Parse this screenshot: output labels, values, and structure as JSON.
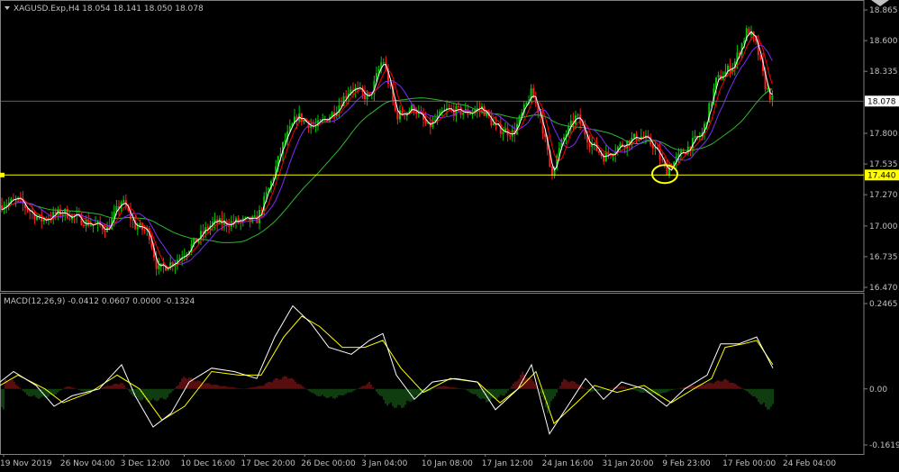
{
  "header": {
    "symbol_line": "XAGUSD.Exp,H4  18.054 18.141 18.050 18.078",
    "indicator_line": "MACD(12,26,9) -0.0412 0.0607 0.0000 -0.1324"
  },
  "colors": {
    "background": "#000000",
    "axis": "#808080",
    "text": "#c0c0c0",
    "bull_bar": "#00c800",
    "bear_bar": "#ff2020",
    "ma_fast": "#ffffff",
    "ma_mid": "#ff0000",
    "ma_slow": "#7a2cff",
    "ma_trend": "#2eb82e",
    "macd_line": "#ffffff",
    "signal_line": "#ffff00",
    "hist_pos": "#b01c1c",
    "hist_neg": "#1f7a1f",
    "level_line": "#ffff00",
    "level_label_bg": "#ffff00",
    "price_label_bg": "#ffffff",
    "marker": "#ffff00"
  },
  "chart_data": [
    {
      "type": "candlestick",
      "title": "XAGUSD.Exp,H4",
      "ohlc_readout": {
        "open": 18.054,
        "high": 18.141,
        "low": 18.05,
        "close": 18.078
      },
      "ylim": [
        16.47,
        18.92
      ],
      "yticks": [
        "18.865",
        "18.600",
        "18.335",
        "18.078",
        "17.800",
        "17.535",
        "17.440",
        "17.270",
        "17.000",
        "16.735",
        "16.470"
      ],
      "current_price": 18.078,
      "horizontal_level": 17.44,
      "current_price_label": "18.078",
      "level_label": "17.440",
      "annotation": "yellow circle near 9 Feb 23:00 at the 17.44 level",
      "close_path": [
        {
          "x": 0,
          "y": 17.18
        },
        {
          "x": 20,
          "y": 17.22
        },
        {
          "x": 45,
          "y": 17.05
        },
        {
          "x": 70,
          "y": 17.12
        },
        {
          "x": 100,
          "y": 17.02
        },
        {
          "x": 120,
          "y": 16.98
        },
        {
          "x": 135,
          "y": 17.22
        },
        {
          "x": 150,
          "y": 17.0
        },
        {
          "x": 165,
          "y": 16.95
        },
        {
          "x": 175,
          "y": 16.62
        },
        {
          "x": 195,
          "y": 16.7
        },
        {
          "x": 215,
          "y": 16.85
        },
        {
          "x": 235,
          "y": 17.02
        },
        {
          "x": 260,
          "y": 17.03
        },
        {
          "x": 285,
          "y": 17.05
        },
        {
          "x": 300,
          "y": 17.35
        },
        {
          "x": 315,
          "y": 17.72
        },
        {
          "x": 330,
          "y": 17.95
        },
        {
          "x": 350,
          "y": 17.85
        },
        {
          "x": 370,
          "y": 17.98
        },
        {
          "x": 390,
          "y": 18.2
        },
        {
          "x": 410,
          "y": 18.1
        },
        {
          "x": 425,
          "y": 18.45
        },
        {
          "x": 440,
          "y": 17.95
        },
        {
          "x": 460,
          "y": 18.02
        },
        {
          "x": 475,
          "y": 17.85
        },
        {
          "x": 495,
          "y": 18.0
        },
        {
          "x": 520,
          "y": 17.98
        },
        {
          "x": 535,
          "y": 18.02
        },
        {
          "x": 550,
          "y": 17.85
        },
        {
          "x": 570,
          "y": 17.8
        },
        {
          "x": 590,
          "y": 18.15
        },
        {
          "x": 600,
          "y": 17.95
        },
        {
          "x": 612,
          "y": 17.45
        },
        {
          "x": 625,
          "y": 17.75
        },
        {
          "x": 640,
          "y": 17.95
        },
        {
          "x": 655,
          "y": 17.72
        },
        {
          "x": 670,
          "y": 17.6
        },
        {
          "x": 690,
          "y": 17.7
        },
        {
          "x": 710,
          "y": 17.78
        },
        {
          "x": 725,
          "y": 17.7
        },
        {
          "x": 740,
          "y": 17.48
        },
        {
          "x": 760,
          "y": 17.65
        },
        {
          "x": 780,
          "y": 17.8
        },
        {
          "x": 795,
          "y": 18.25
        },
        {
          "x": 815,
          "y": 18.4
        },
        {
          "x": 830,
          "y": 18.7
        },
        {
          "x": 840,
          "y": 18.55
        },
        {
          "x": 850,
          "y": 18.2
        },
        {
          "x": 858,
          "y": 18.078
        }
      ],
      "xticks": [
        "19 Nov 2019",
        "26 Nov 04:00",
        "3 Dec 12:00",
        "10 Dec 16:00",
        "17 Dec 20:00",
        "26 Dec 00:00",
        "3 Jan 04:00",
        "10 Jan 08:00",
        "17 Jan 12:00",
        "24 Jan 16:00",
        "31 Jan 20:00",
        "9 Feb 23:00",
        "17 Feb 00:00",
        "24 Feb 04:00"
      ],
      "indicators": [
        "fast MA (white)",
        "MA (red)",
        "MA (purple)",
        "slow MA (green)"
      ]
    },
    {
      "type": "macd",
      "title": "MACD(12,26,9)",
      "readout": [
        "-0.0412",
        "0.0607",
        "0.0000",
        "-0.1324"
      ],
      "ylim": [
        -0.1619,
        0.2465
      ],
      "yticks": [
        "0.2465",
        "0.00",
        "-0.1619"
      ],
      "macd_path": [
        {
          "x": 0,
          "y": 0.02
        },
        {
          "x": 15,
          "y": 0.05
        },
        {
          "x": 40,
          "y": 0.01
        },
        {
          "x": 60,
          "y": -0.05
        },
        {
          "x": 80,
          "y": -0.02
        },
        {
          "x": 110,
          "y": 0.0
        },
        {
          "x": 135,
          "y": 0.07
        },
        {
          "x": 150,
          "y": -0.02
        },
        {
          "x": 170,
          "y": -0.11
        },
        {
          "x": 190,
          "y": -0.07
        },
        {
          "x": 210,
          "y": 0.02
        },
        {
          "x": 235,
          "y": 0.06
        },
        {
          "x": 260,
          "y": 0.05
        },
        {
          "x": 285,
          "y": 0.03
        },
        {
          "x": 305,
          "y": 0.15
        },
        {
          "x": 325,
          "y": 0.24
        },
        {
          "x": 345,
          "y": 0.19
        },
        {
          "x": 365,
          "y": 0.12
        },
        {
          "x": 390,
          "y": 0.1
        },
        {
          "x": 410,
          "y": 0.14
        },
        {
          "x": 425,
          "y": 0.16
        },
        {
          "x": 440,
          "y": 0.04
        },
        {
          "x": 460,
          "y": -0.03
        },
        {
          "x": 480,
          "y": 0.02
        },
        {
          "x": 505,
          "y": 0.03
        },
        {
          "x": 530,
          "y": 0.02
        },
        {
          "x": 550,
          "y": -0.06
        },
        {
          "x": 575,
          "y": 0.0
        },
        {
          "x": 590,
          "y": 0.07
        },
        {
          "x": 610,
          "y": -0.13
        },
        {
          "x": 630,
          "y": -0.05
        },
        {
          "x": 650,
          "y": 0.03
        },
        {
          "x": 670,
          "y": -0.03
        },
        {
          "x": 690,
          "y": 0.02
        },
        {
          "x": 715,
          "y": 0.0
        },
        {
          "x": 740,
          "y": -0.05
        },
        {
          "x": 760,
          "y": 0.0
        },
        {
          "x": 785,
          "y": 0.04
        },
        {
          "x": 800,
          "y": 0.13
        },
        {
          "x": 820,
          "y": 0.13
        },
        {
          "x": 840,
          "y": 0.15
        },
        {
          "x": 858,
          "y": 0.06
        }
      ],
      "signal_path": [
        {
          "x": 0,
          "y": 0.01
        },
        {
          "x": 20,
          "y": 0.04
        },
        {
          "x": 50,
          "y": 0.0
        },
        {
          "x": 70,
          "y": -0.04
        },
        {
          "x": 100,
          "y": -0.01
        },
        {
          "x": 130,
          "y": 0.04
        },
        {
          "x": 155,
          "y": 0.0
        },
        {
          "x": 180,
          "y": -0.09
        },
        {
          "x": 205,
          "y": -0.05
        },
        {
          "x": 235,
          "y": 0.05
        },
        {
          "x": 265,
          "y": 0.04
        },
        {
          "x": 290,
          "y": 0.04
        },
        {
          "x": 315,
          "y": 0.15
        },
        {
          "x": 335,
          "y": 0.21
        },
        {
          "x": 355,
          "y": 0.18
        },
        {
          "x": 380,
          "y": 0.12
        },
        {
          "x": 405,
          "y": 0.12
        },
        {
          "x": 425,
          "y": 0.14
        },
        {
          "x": 445,
          "y": 0.06
        },
        {
          "x": 470,
          "y": -0.01
        },
        {
          "x": 500,
          "y": 0.03
        },
        {
          "x": 530,
          "y": 0.02
        },
        {
          "x": 555,
          "y": -0.04
        },
        {
          "x": 580,
          "y": 0.01
        },
        {
          "x": 595,
          "y": 0.05
        },
        {
          "x": 615,
          "y": -0.1
        },
        {
          "x": 640,
          "y": -0.04
        },
        {
          "x": 660,
          "y": 0.01
        },
        {
          "x": 685,
          "y": -0.01
        },
        {
          "x": 715,
          "y": 0.01
        },
        {
          "x": 745,
          "y": -0.04
        },
        {
          "x": 770,
          "y": 0.0
        },
        {
          "x": 790,
          "y": 0.03
        },
        {
          "x": 805,
          "y": 0.12
        },
        {
          "x": 825,
          "y": 0.13
        },
        {
          "x": 840,
          "y": 0.14
        },
        {
          "x": 858,
          "y": 0.07
        }
      ],
      "histogram": [
        {
          "x": 5,
          "y": 0.03
        },
        {
          "x": 15,
          "y": 0.025
        },
        {
          "x": 30,
          "y": -0.02
        },
        {
          "x": 45,
          "y": -0.03
        },
        {
          "x": 60,
          "y": -0.02
        },
        {
          "x": 75,
          "y": 0.01
        },
        {
          "x": 95,
          "y": -0.01
        },
        {
          "x": 120,
          "y": 0.01
        },
        {
          "x": 135,
          "y": 0.02
        },
        {
          "x": 150,
          "y": -0.03
        },
        {
          "x": 165,
          "y": -0.04
        },
        {
          "x": 185,
          "y": -0.03
        },
        {
          "x": 205,
          "y": 0.04
        },
        {
          "x": 225,
          "y": 0.02
        },
        {
          "x": 245,
          "y": 0.01
        },
        {
          "x": 270,
          "y": 0.0
        },
        {
          "x": 290,
          "y": 0.01
        },
        {
          "x": 305,
          "y": 0.03
        },
        {
          "x": 320,
          "y": 0.04
        },
        {
          "x": 335,
          "y": 0.01
        },
        {
          "x": 350,
          "y": -0.02
        },
        {
          "x": 370,
          "y": -0.03
        },
        {
          "x": 390,
          "y": -0.01
        },
        {
          "x": 410,
          "y": 0.02
        },
        {
          "x": 430,
          "y": -0.05
        },
        {
          "x": 445,
          "y": -0.06
        },
        {
          "x": 465,
          "y": -0.02
        },
        {
          "x": 490,
          "y": 0.01
        },
        {
          "x": 515,
          "y": 0.0
        },
        {
          "x": 540,
          "y": -0.04
        },
        {
          "x": 560,
          "y": -0.02
        },
        {
          "x": 580,
          "y": 0.05
        },
        {
          "x": 595,
          "y": 0.02
        },
        {
          "x": 608,
          "y": -0.07
        },
        {
          "x": 625,
          "y": 0.03
        },
        {
          "x": 640,
          "y": 0.02
        },
        {
          "x": 655,
          "y": -0.01
        },
        {
          "x": 675,
          "y": 0.0
        },
        {
          "x": 690,
          "y": 0.01
        },
        {
          "x": 710,
          "y": -0.01
        },
        {
          "x": 730,
          "y": -0.02
        },
        {
          "x": 750,
          "y": 0.0
        },
        {
          "x": 770,
          "y": 0.01
        },
        {
          "x": 790,
          "y": 0.02
        },
        {
          "x": 805,
          "y": 0.03
        },
        {
          "x": 820,
          "y": 0.01
        },
        {
          "x": 835,
          "y": -0.02
        },
        {
          "x": 850,
          "y": -0.06
        }
      ]
    }
  ]
}
